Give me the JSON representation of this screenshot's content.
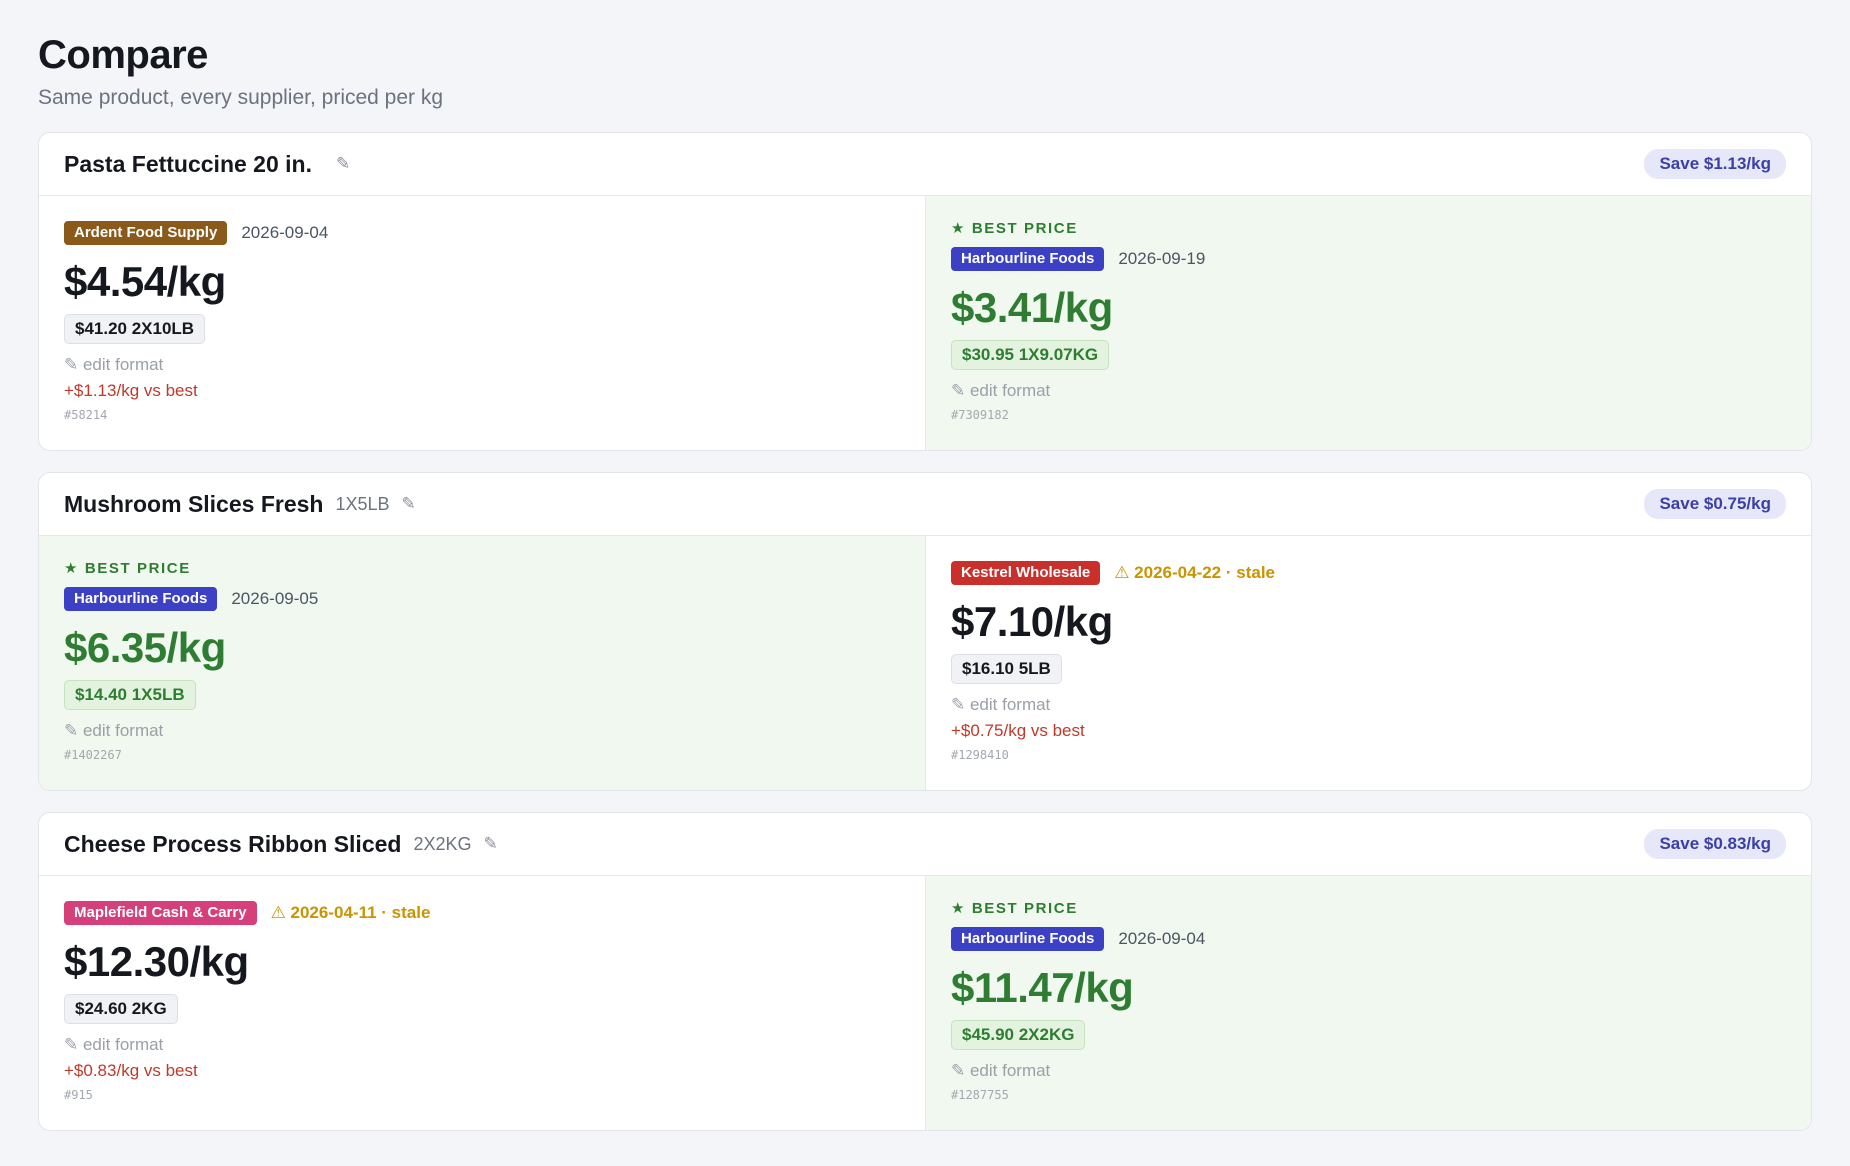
{
  "page": {
    "title": "Compare",
    "subtitle": "Same product, every supplier, priced per kg"
  },
  "icons": {
    "edit": "pencil-icon",
    "best": "star-icon",
    "warning": "warning-icon"
  },
  "labels": {
    "edit_pencil": "✎",
    "edit_format": "✎ edit format",
    "best_price": "★ BEST PRICE"
  },
  "colors": {
    "best_green": "#2e7d32",
    "worse_red": "#c0392b",
    "stale_amber": "#c99400",
    "save_badge": "#3b3fa6"
  },
  "cards": [
    {
      "product": "Pasta Fettuccine 20 in.",
      "size": "",
      "save": "Save $1.13/kg",
      "offers": [
        {
          "best": false,
          "supplier": "Ardent Food Supply",
          "supplier_color": "#8a5a1a",
          "date": "2026-09-04",
          "stale": false,
          "price": "$4.54/kg",
          "pack": "$41.20 2X10LB",
          "edit": "✎ edit format",
          "diff": "+$1.13/kg vs best",
          "id": "#58214"
        },
        {
          "best": true,
          "supplier": "Harbourline Foods",
          "supplier_color": "#3b40c4",
          "date": "2026-09-19",
          "stale": false,
          "price": "$3.41/kg",
          "pack": "$30.95 1X9.07KG",
          "edit": "✎ edit format",
          "diff": "",
          "id": "#7309182"
        }
      ]
    },
    {
      "product": "Mushroom Slices Fresh",
      "size": "1X5LB",
      "save": "Save $0.75/kg",
      "offers": [
        {
          "best": true,
          "supplier": "Harbourline Foods",
          "supplier_color": "#3b40c4",
          "date": "2026-09-05",
          "stale": false,
          "price": "$6.35/kg",
          "pack": "$14.40 1X5LB",
          "edit": "✎ edit format",
          "diff": "",
          "id": "#1402267"
        },
        {
          "best": false,
          "supplier": "Kestrel Wholesale",
          "supplier_color": "#c9302c",
          "date": "⚠ 2026-04-22 · stale",
          "stale": true,
          "price": "$7.10/kg",
          "pack": "$16.10 5LB",
          "edit": "✎ edit format",
          "diff": "+$0.75/kg vs best",
          "id": "#1298410"
        }
      ]
    },
    {
      "product": "Cheese Process Ribbon Sliced",
      "size": "2X2KG",
      "save": "Save $0.83/kg",
      "offers": [
        {
          "best": false,
          "supplier": "Maplefield Cash & Carry",
          "supplier_color": "#d6407a",
          "date": "⚠ 2026-04-11 · stale",
          "stale": true,
          "price": "$12.30/kg",
          "pack": "$24.60 2KG",
          "edit": "✎ edit format",
          "diff": "+$0.83/kg vs best",
          "id": "#915"
        },
        {
          "best": true,
          "supplier": "Harbourline Foods",
          "supplier_color": "#3b40c4",
          "date": "2026-09-04",
          "stale": false,
          "price": "$11.47/kg",
          "pack": "$45.90 2X2KG",
          "edit": "✎ edit format",
          "diff": "",
          "id": "#1287755"
        }
      ]
    }
  ]
}
